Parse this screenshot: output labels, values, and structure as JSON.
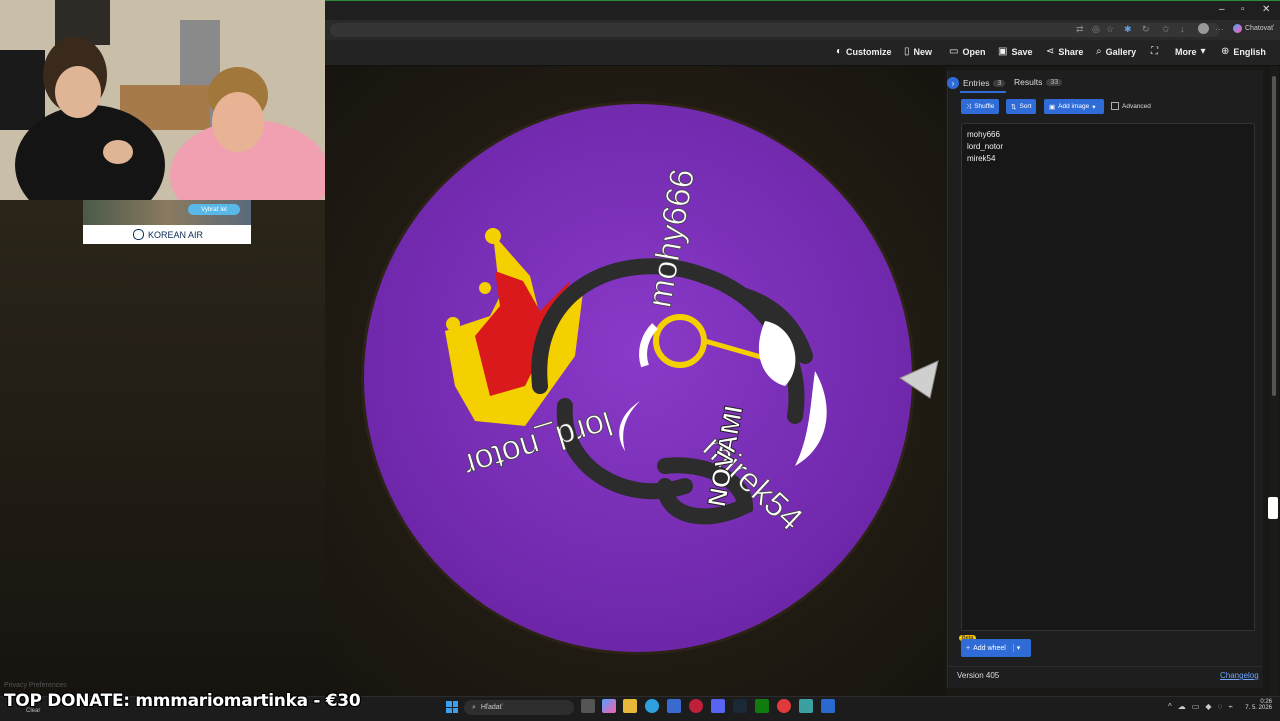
{
  "browser": {
    "chat_label": "Chatovať"
  },
  "toolbar": {
    "customize": "Customize",
    "new": "New",
    "open": "Open",
    "save": "Save",
    "share": "Share",
    "gallery": "Gallery",
    "more": "More",
    "language": "English"
  },
  "wheel": {
    "slices": [
      "mohy666",
      "lord_notor",
      "mirek54"
    ],
    "center_color": "#7a2fb7",
    "logo_text": "NOVAMI"
  },
  "panel": {
    "tabs": [
      {
        "label": "Entries",
        "count": "3"
      },
      {
        "label": "Results",
        "count": "33"
      }
    ],
    "buttons": {
      "shuffle": "Shuffle",
      "sort": "Sort",
      "add_image": "Add image",
      "advanced": "Advanced"
    },
    "entries": [
      "mohy666",
      "lord_notor",
      "mirek54"
    ],
    "add_wheel": "Add wheel",
    "beta": "Beta",
    "version": "Version 405",
    "changelog": "Changelog"
  },
  "ad": {
    "brand": "KOREAN AIR",
    "cta": "Vybrať let"
  },
  "overlay": {
    "donate": "TOP DONATE: mmmariomartinka - €30",
    "privacy": "Privacy Preferences"
  },
  "taskbar": {
    "weather": "Clear",
    "search_placeholder": "Hľadať",
    "time": "0:26",
    "date": "7. 5. 2026"
  },
  "colors": {
    "accent": "#2f6cd8",
    "wheel_purple": "#7a2fb7",
    "crown_yellow": "#f5d000",
    "crown_red": "#d9191c"
  }
}
